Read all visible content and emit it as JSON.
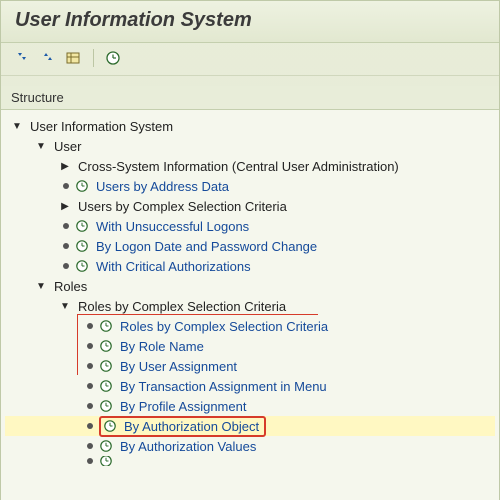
{
  "title": "User Information System",
  "structure_label": "Structure",
  "toolbar": {
    "expand_all": "expand-all",
    "collapse_all": "collapse-all",
    "variant": "select-variant",
    "execute": "execute"
  },
  "tree": {
    "root": "User Information System",
    "user": {
      "label": "User",
      "items": {
        "cross": "Cross-System Information (Central User Administration)",
        "address": "Users by Address Data",
        "complex": "Users by Complex Selection Criteria",
        "unsuccessful": "With Unsuccessful Logons",
        "logon_date": "By Logon Date and Password Change",
        "critical": "With Critical Authorizations"
      }
    },
    "roles": {
      "label": "Roles",
      "complex_label": "Roles by Complex Selection Criteria",
      "items": {
        "complex_criteria": "Roles by Complex Selection Criteria",
        "role_name": "By Role Name",
        "user_assignment": "By User Assignment",
        "txn_assignment": "By Transaction Assignment in Menu",
        "profile_assignment": "By Profile Assignment",
        "auth_object": "By Authorization Object",
        "auth_values": "By Authorization Values"
      }
    }
  }
}
